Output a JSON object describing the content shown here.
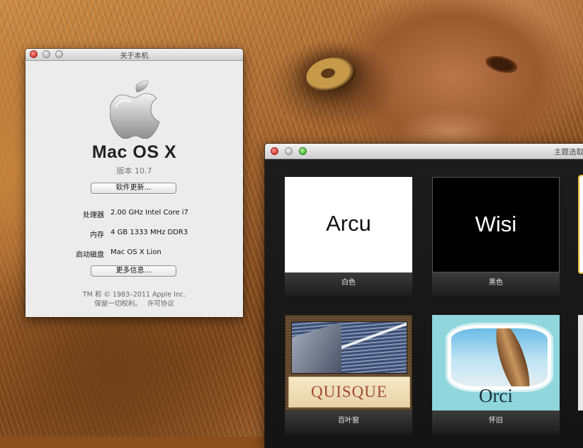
{
  "about_window": {
    "title": "关于本机",
    "os_name": "Mac OS X",
    "version": "版本 10.7",
    "software_update_label": "软件更新…",
    "specs": [
      {
        "label": "处理器",
        "value": "2.00 GHz Intel Core i7"
      },
      {
        "label": "内存",
        "value": "4 GB 1333 MHz DDR3"
      },
      {
        "label": "启动磁盘",
        "value": "Mac OS X Lion"
      }
    ],
    "more_info_label": "更多信息…",
    "copyright": "TM 和 © 1983–2011 Apple Inc.",
    "rights_text": "保留一切权利。",
    "license_link": "许可协议"
  },
  "theme_window": {
    "title": "主题选取",
    "themes": [
      {
        "name": "白色",
        "preview_text": "Arcu",
        "selected": false
      },
      {
        "name": "黑色",
        "preview_text": "Wisi",
        "selected": false
      },
      {
        "name": "百叶窗",
        "preview_text": "QUISQUE",
        "selected": false
      },
      {
        "name": "怀旧",
        "preview_text": "Orci",
        "selected": false
      }
    ],
    "partially_visible_theme_selected": true
  },
  "colors": {
    "selection_outline": "#e6b73a",
    "close_button": "#e0443a",
    "zoom_button": "#5bc249"
  },
  "icons": [
    "apple-logo",
    "close-button",
    "minimize-button",
    "zoom-button"
  ]
}
